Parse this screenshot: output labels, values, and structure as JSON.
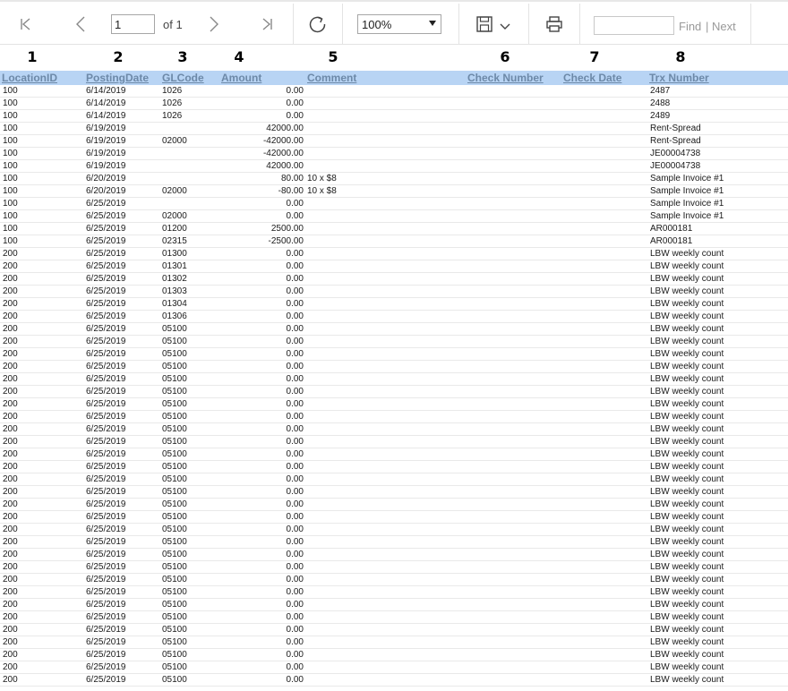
{
  "toolbar": {
    "page_value": "1",
    "page_of": "of 1",
    "zoom": "100%",
    "find_label": "Find",
    "separator": "|",
    "next_label": "Next"
  },
  "column_numbers": [
    "1",
    "2",
    "3",
    "4",
    "5",
    "6",
    "7",
    "8"
  ],
  "columns": {
    "location_id": "LocationID",
    "posting_date": "PostingDate",
    "gl_code": "GLCode",
    "amount": "Amount",
    "comment": "Comment",
    "check_number": "Check Number",
    "check_date": "Check Date",
    "trx_number": "Trx Number"
  },
  "rows": [
    {
      "loc": "100",
      "date": "6/14/2019",
      "gl": "1026",
      "amt": "0.00",
      "com": "",
      "trx": "2487"
    },
    {
      "loc": "100",
      "date": "6/14/2019",
      "gl": "1026",
      "amt": "0.00",
      "com": "",
      "trx": "2488"
    },
    {
      "loc": "100",
      "date": "6/14/2019",
      "gl": "1026",
      "amt": "0.00",
      "com": "",
      "trx": "2489"
    },
    {
      "loc": "100",
      "date": "6/19/2019",
      "gl": "",
      "amt": "42000.00",
      "com": "",
      "trx": "Rent-Spread"
    },
    {
      "loc": "100",
      "date": "6/19/2019",
      "gl": "02000",
      "amt": "-42000.00",
      "com": "",
      "trx": "Rent-Spread"
    },
    {
      "loc": "100",
      "date": "6/19/2019",
      "gl": "",
      "amt": "-42000.00",
      "com": "",
      "trx": "JE00004738"
    },
    {
      "loc": "100",
      "date": "6/19/2019",
      "gl": "",
      "amt": "42000.00",
      "com": "",
      "trx": "JE00004738"
    },
    {
      "loc": "100",
      "date": "6/20/2019",
      "gl": "",
      "amt": "80.00",
      "com": "10 x $8",
      "trx": "Sample Invoice #1"
    },
    {
      "loc": "100",
      "date": "6/20/2019",
      "gl": "02000",
      "amt": "-80.00",
      "com": "10 x $8",
      "trx": "Sample Invoice #1"
    },
    {
      "loc": "100",
      "date": "6/25/2019",
      "gl": "",
      "amt": "0.00",
      "com": "",
      "trx": "Sample Invoice #1"
    },
    {
      "loc": "100",
      "date": "6/25/2019",
      "gl": "02000",
      "amt": "0.00",
      "com": "",
      "trx": "Sample Invoice #1"
    },
    {
      "loc": "100",
      "date": "6/25/2019",
      "gl": "01200",
      "amt": "2500.00",
      "com": "",
      "trx": "AR000181"
    },
    {
      "loc": "100",
      "date": "6/25/2019",
      "gl": "02315",
      "amt": "-2500.00",
      "com": "",
      "trx": "AR000181"
    },
    {
      "loc": "200",
      "date": "6/25/2019",
      "gl": "01300",
      "amt": "0.00",
      "com": "",
      "trx": "LBW weekly count"
    },
    {
      "loc": "200",
      "date": "6/25/2019",
      "gl": "01301",
      "amt": "0.00",
      "com": "",
      "trx": "LBW weekly count"
    },
    {
      "loc": "200",
      "date": "6/25/2019",
      "gl": "01302",
      "amt": "0.00",
      "com": "",
      "trx": "LBW weekly count"
    },
    {
      "loc": "200",
      "date": "6/25/2019",
      "gl": "01303",
      "amt": "0.00",
      "com": "",
      "trx": "LBW weekly count"
    },
    {
      "loc": "200",
      "date": "6/25/2019",
      "gl": "01304",
      "amt": "0.00",
      "com": "",
      "trx": "LBW weekly count"
    },
    {
      "loc": "200",
      "date": "6/25/2019",
      "gl": "01306",
      "amt": "0.00",
      "com": "",
      "trx": "LBW weekly count"
    },
    {
      "loc": "200",
      "date": "6/25/2019",
      "gl": "05100",
      "amt": "0.00",
      "com": "",
      "trx": "LBW weekly count"
    },
    {
      "loc": "200",
      "date": "6/25/2019",
      "gl": "05100",
      "amt": "0.00",
      "com": "",
      "trx": "LBW weekly count"
    },
    {
      "loc": "200",
      "date": "6/25/2019",
      "gl": "05100",
      "amt": "0.00",
      "com": "",
      "trx": "LBW weekly count"
    },
    {
      "loc": "200",
      "date": "6/25/2019",
      "gl": "05100",
      "amt": "0.00",
      "com": "",
      "trx": "LBW weekly count"
    },
    {
      "loc": "200",
      "date": "6/25/2019",
      "gl": "05100",
      "amt": "0.00",
      "com": "",
      "trx": "LBW weekly count"
    },
    {
      "loc": "200",
      "date": "6/25/2019",
      "gl": "05100",
      "amt": "0.00",
      "com": "",
      "trx": "LBW weekly count"
    },
    {
      "loc": "200",
      "date": "6/25/2019",
      "gl": "05100",
      "amt": "0.00",
      "com": "",
      "trx": "LBW weekly count"
    },
    {
      "loc": "200",
      "date": "6/25/2019",
      "gl": "05100",
      "amt": "0.00",
      "com": "",
      "trx": "LBW weekly count"
    },
    {
      "loc": "200",
      "date": "6/25/2019",
      "gl": "05100",
      "amt": "0.00",
      "com": "",
      "trx": "LBW weekly count"
    },
    {
      "loc": "200",
      "date": "6/25/2019",
      "gl": "05100",
      "amt": "0.00",
      "com": "",
      "trx": "LBW weekly count"
    },
    {
      "loc": "200",
      "date": "6/25/2019",
      "gl": "05100",
      "amt": "0.00",
      "com": "",
      "trx": "LBW weekly count"
    },
    {
      "loc": "200",
      "date": "6/25/2019",
      "gl": "05100",
      "amt": "0.00",
      "com": "",
      "trx": "LBW weekly count"
    },
    {
      "loc": "200",
      "date": "6/25/2019",
      "gl": "05100",
      "amt": "0.00",
      "com": "",
      "trx": "LBW weekly count"
    },
    {
      "loc": "200",
      "date": "6/25/2019",
      "gl": "05100",
      "amt": "0.00",
      "com": "",
      "trx": "LBW weekly count"
    },
    {
      "loc": "200",
      "date": "6/25/2019",
      "gl": "05100",
      "amt": "0.00",
      "com": "",
      "trx": "LBW weekly count"
    },
    {
      "loc": "200",
      "date": "6/25/2019",
      "gl": "05100",
      "amt": "0.00",
      "com": "",
      "trx": "LBW weekly count"
    },
    {
      "loc": "200",
      "date": "6/25/2019",
      "gl": "05100",
      "amt": "0.00",
      "com": "",
      "trx": "LBW weekly count"
    },
    {
      "loc": "200",
      "date": "6/25/2019",
      "gl": "05100",
      "amt": "0.00",
      "com": "",
      "trx": "LBW weekly count"
    },
    {
      "loc": "200",
      "date": "6/25/2019",
      "gl": "05100",
      "amt": "0.00",
      "com": "",
      "trx": "LBW weekly count"
    },
    {
      "loc": "200",
      "date": "6/25/2019",
      "gl": "05100",
      "amt": "0.00",
      "com": "",
      "trx": "LBW weekly count"
    },
    {
      "loc": "200",
      "date": "6/25/2019",
      "gl": "05100",
      "amt": "0.00",
      "com": "",
      "trx": "LBW weekly count"
    },
    {
      "loc": "200",
      "date": "6/25/2019",
      "gl": "05100",
      "amt": "0.00",
      "com": "",
      "trx": "LBW weekly count"
    },
    {
      "loc": "200",
      "date": "6/25/2019",
      "gl": "05100",
      "amt": "0.00",
      "com": "",
      "trx": "LBW weekly count"
    },
    {
      "loc": "200",
      "date": "6/25/2019",
      "gl": "05100",
      "amt": "0.00",
      "com": "",
      "trx": "LBW weekly count"
    },
    {
      "loc": "200",
      "date": "6/25/2019",
      "gl": "05100",
      "amt": "0.00",
      "com": "",
      "trx": "LBW weekly count"
    },
    {
      "loc": "200",
      "date": "6/25/2019",
      "gl": "05100",
      "amt": "0.00",
      "com": "",
      "trx": "LBW weekly count"
    },
    {
      "loc": "200",
      "date": "6/25/2019",
      "gl": "05100",
      "amt": "0.00",
      "com": "",
      "trx": "LBW weekly count"
    },
    {
      "loc": "200",
      "date": "6/25/2019",
      "gl": "05100",
      "amt": "0.00",
      "com": "",
      "trx": "LBW weekly count"
    },
    {
      "loc": "200",
      "date": "6/25/2019",
      "gl": "05100",
      "amt": "0.00",
      "com": "",
      "trx": "LBW weekly count"
    }
  ]
}
